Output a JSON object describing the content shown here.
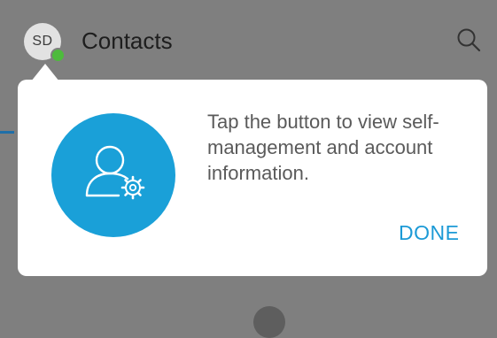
{
  "app_bar": {
    "avatar_initials": "SD",
    "title": "Contacts",
    "search_icon": "search-icon",
    "presence_color": "#4dbb3c"
  },
  "popover": {
    "icon": "user-settings-icon",
    "icon_background": "#1aa0d8",
    "message": "Tap the button to view self-management and account information.",
    "done_label": "DONE",
    "accent_color": "#1c9ad6"
  }
}
